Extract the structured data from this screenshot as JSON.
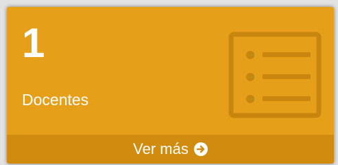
{
  "card": {
    "count": "1",
    "label": "Docentes",
    "footer_link": "Ver más",
    "icon": "list-icon",
    "footer_icon": "arrow-circle-right-icon",
    "colors": {
      "background": "#e59f19",
      "footer": "#d18c0f",
      "icon": "#c8860f",
      "text": "#ffffff"
    }
  }
}
